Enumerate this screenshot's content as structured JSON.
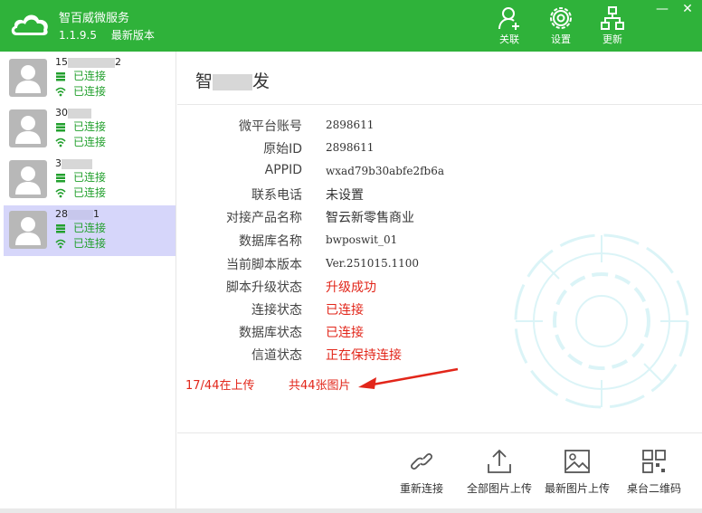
{
  "app": {
    "title": "智百威微服务",
    "version": "1.1.9.5",
    "version_note": "最新版本"
  },
  "header_buttons": {
    "follow": "关联",
    "settings": "设置",
    "update": "更新"
  },
  "window_controls": {
    "minimize": "—",
    "close": "✕"
  },
  "clients": [
    {
      "id_prefix": "15",
      "id_suffix": "2",
      "status1": "已连接",
      "status2": "已连接"
    },
    {
      "id_prefix": "30",
      "id_suffix": "",
      "status1": "已连接",
      "status2": "已连接"
    },
    {
      "id_prefix": "3",
      "id_suffix": "",
      "status1": "已连接",
      "status2": "已连接"
    },
    {
      "id_prefix": "28",
      "id_suffix": "1",
      "status1": "已连接",
      "status2": "已连接",
      "selected": true
    }
  ],
  "main": {
    "title_prefix": "智",
    "title_suffix": "发",
    "rows": [
      {
        "label": "微平台账号",
        "value": "2898611"
      },
      {
        "label": "原始ID",
        "value": "2898611"
      },
      {
        "label": "APPID",
        "value": "wxad79b30abfe2fb6a"
      },
      {
        "label": "联系电话",
        "value": "未设置"
      },
      {
        "label": "对接产品名称",
        "value": "智云新零售商业"
      },
      {
        "label": "数据库名称",
        "value": "bwposwit_01"
      },
      {
        "label": "当前脚本版本",
        "value": "Ver.251015.1100"
      },
      {
        "label": "脚本升级状态",
        "value": "升级成功"
      },
      {
        "label": "连接状态",
        "value": "已连接"
      },
      {
        "label": "数据库状态",
        "value": "已连接"
      },
      {
        "label": "信道状态",
        "value": "正在保持连接"
      }
    ],
    "upload_progress": "17/44在上传",
    "upload_total": "共44张图片"
  },
  "footer_buttons": {
    "reconnect": "重新连接",
    "upload_all": "全部图片上传",
    "upload_latest": "最新图片上传",
    "qrcode": "桌台二维码"
  },
  "colors": {
    "header_green": "#2fb23a",
    "status_green": "#22a02d",
    "alert_red": "#e2261a",
    "selected_row": "#d6d6fa"
  }
}
